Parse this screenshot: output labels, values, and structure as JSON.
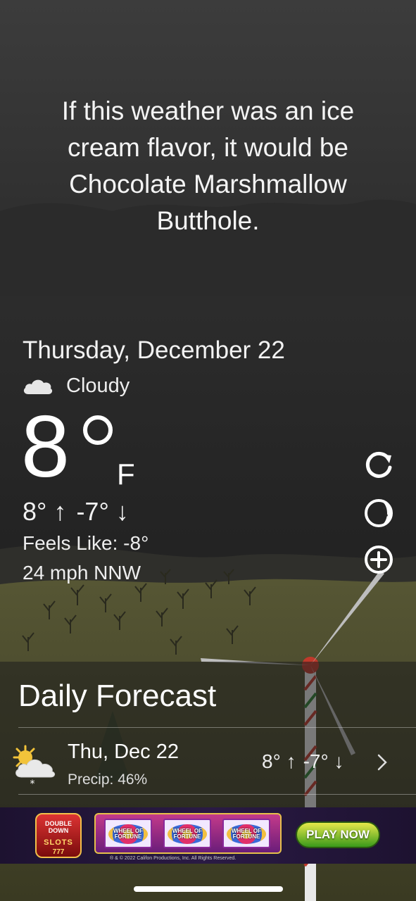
{
  "quip": "If this weather was an ice cream flavor, it would be Chocolate Marshmallow Butthole.",
  "current": {
    "date": "Thursday, December 22",
    "condition": "Cloudy",
    "condition_icon": "cloud-icon",
    "temperature": "8",
    "unit": "F",
    "high": "8°",
    "low": "-7°",
    "feels_like": "Feels Like: -8°",
    "wind": "24 mph NNW"
  },
  "actions": [
    {
      "name": "refresh-button",
      "icon": "refresh-icon"
    },
    {
      "name": "moon-phase-button",
      "icon": "moon-icon"
    },
    {
      "name": "add-location-button",
      "icon": "plus-circle-icon"
    }
  ],
  "forecast": {
    "title": "Daily Forecast",
    "days": [
      {
        "day": "Thu, Dec 22",
        "precip": "Precip: 46%",
        "icon": "partly-cloudy-snow-icon",
        "high": "8°",
        "low": "-7°"
      }
    ]
  },
  "ad": {
    "logo_line1": "DOUBLE DOWN",
    "logo_line2": "SLOTS",
    "logo_line3": "777",
    "reel_label": "WHEEL OF FORTUNE",
    "cta": "PLAY NOW",
    "legal": "® & © 2022 Califon Productions, Inc. All Rights Reserved."
  },
  "colors": {
    "sky": "#3a3a3a",
    "hill": "#4a4a2e",
    "panel": "#1e1e1e"
  }
}
